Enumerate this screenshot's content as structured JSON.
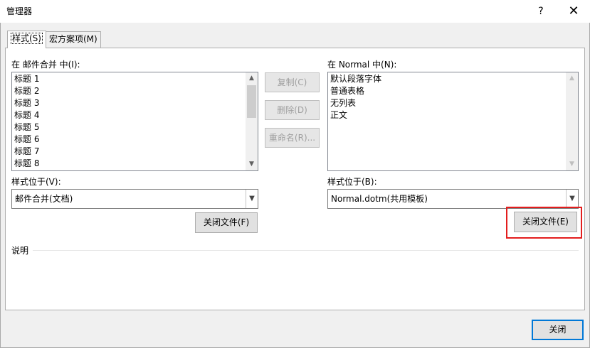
{
  "window": {
    "title": "管理器",
    "help_label": "?",
    "close_label": "✕"
  },
  "tabs": [
    {
      "label": "样式(S)",
      "active": true
    },
    {
      "label": "宏方案项(M)",
      "active": false
    }
  ],
  "left": {
    "list_label": "在 邮件合并 中(I):",
    "items": [
      "标题 1",
      "标题 2",
      "标题 3",
      "标题 4",
      "标题 5",
      "标题 6",
      "标题 7",
      "标题 8"
    ],
    "location_label": "样式位于(V):",
    "location_value": "邮件合并(文档)",
    "close_file_label": "关闭文件(F)"
  },
  "middle": {
    "copy_label": "复制(C)",
    "delete_label": "删除(D)",
    "rename_label": "重命名(R)..."
  },
  "right": {
    "list_label": "在 Normal 中(N):",
    "items": [
      "默认段落字体",
      "普通表格",
      "无列表",
      "正文"
    ],
    "location_label": "样式位于(B):",
    "location_value": "Normal.dotm(共用模板)",
    "close_file_label": "关闭文件(E)"
  },
  "description": {
    "label": "说明"
  },
  "footer": {
    "close_label": "关闭"
  },
  "icons": {
    "up": "chevron-up-icon",
    "down": "chevron-down-icon"
  },
  "colors": {
    "highlight": "#e31d1d",
    "default_button": "#0078d7"
  }
}
